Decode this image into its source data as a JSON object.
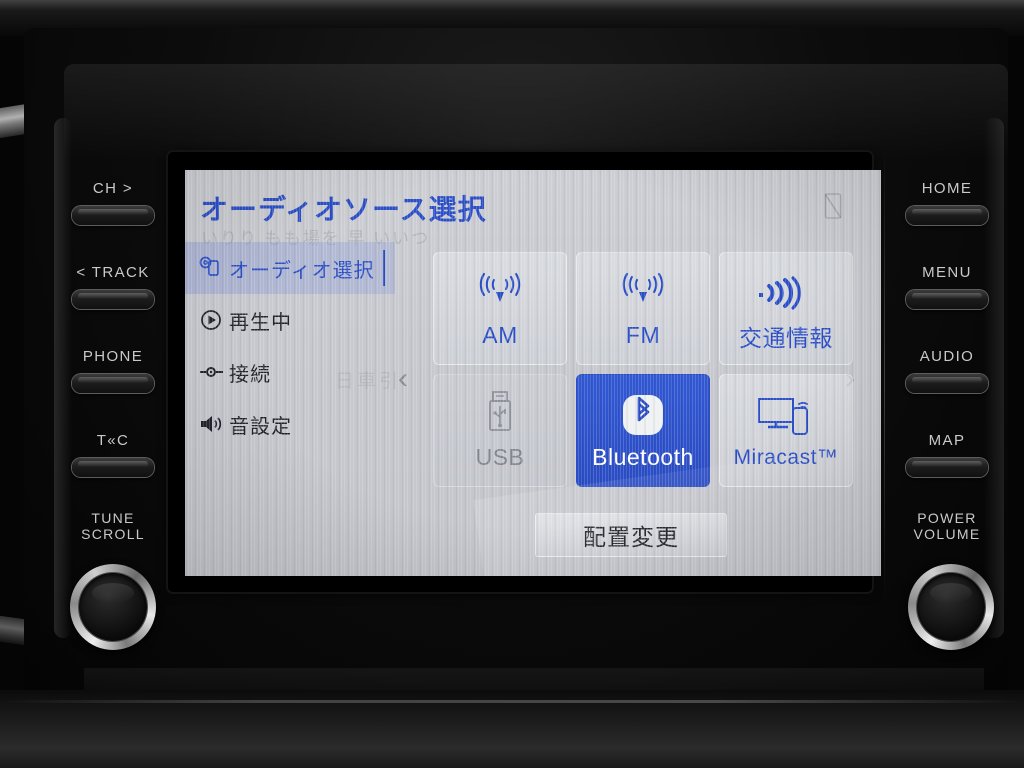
{
  "screen": {
    "title": "オーディオソース選択",
    "status_icon": "no-signal-icon",
    "ghost_text": "いりり もも場を 早 いいつ",
    "nav_left": "‹",
    "nav_right": "›"
  },
  "sidebar": {
    "items": [
      {
        "label": "オーディオ選択",
        "icon": "audio-source-disc-icon",
        "active": true
      },
      {
        "label": "再生中",
        "icon": "play-circle-icon",
        "active": false
      },
      {
        "label": "接続",
        "icon": "connection-plug-icon",
        "active": false
      },
      {
        "label": "音設定",
        "icon": "speaker-icon",
        "active": false
      }
    ]
  },
  "sources": {
    "rows": [
      [
        {
          "label": "AM",
          "icon": "antenna-icon",
          "state": "normal"
        },
        {
          "label": "FM",
          "icon": "antenna-icon",
          "state": "normal"
        },
        {
          "label": "交通情報",
          "icon": "broadcast-bars-icon",
          "state": "normal"
        }
      ],
      [
        {
          "label": "USB",
          "icon": "usb-plug-icon",
          "state": "disabled"
        },
        {
          "label": "Bluetooth",
          "icon": "bluetooth-icon",
          "state": "selected"
        },
        {
          "label": "Miracast™",
          "icon": "screen-cast-icon",
          "state": "normal"
        }
      ]
    ]
  },
  "rearrange_button": {
    "label": "配置変更"
  },
  "left_keys": [
    {
      "label": "CH >"
    },
    {
      "label": "< TRACK"
    },
    {
      "label": "PHONE"
    },
    {
      "label": "T«C"
    }
  ],
  "left_knob": {
    "line1": "TUNE",
    "line2": "SCROLL"
  },
  "right_keys": [
    {
      "label": "HOME"
    },
    {
      "label": "MENU"
    },
    {
      "label": "AUDIO"
    },
    {
      "label": "MAP"
    }
  ],
  "right_knob": {
    "line1": "POWER",
    "line2": "VOLUME"
  },
  "colors": {
    "accent_blue": "#2b4fc8",
    "selected_tile": "#2a4cc4",
    "lcd_background": "#c7c9cf",
    "disabled_text": "#83868f"
  }
}
